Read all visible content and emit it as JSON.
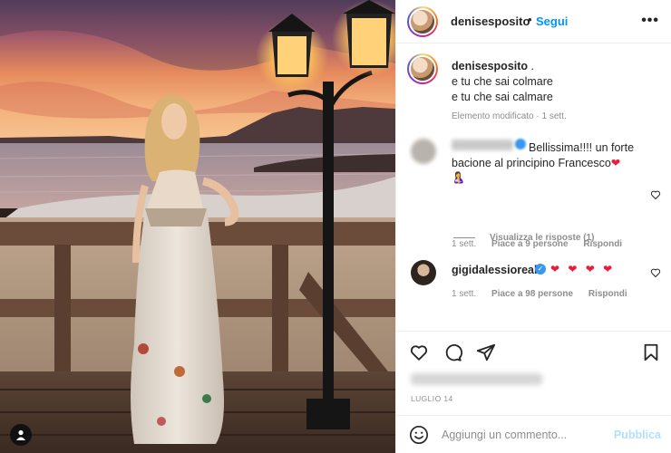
{
  "post": {
    "author": "denisesposito",
    "follow_label": "Segui",
    "header_separator": "•",
    "more_label": "•••"
  },
  "caption": {
    "username": "denisesposito",
    "text_suffix": " .",
    "line2": "e tu che sai colmare",
    "line3": "e tu che sai calmare",
    "meta": "Elemento modificato · 1 sett."
  },
  "comments": [
    {
      "username_blurred": true,
      "text": "Bellissima!!!! un forte",
      "text_line2": "bacione al principino Francesco",
      "trailing_emoji": "❤",
      "line3_emoji": "🤱",
      "time": "1 sett.",
      "likes": "Piace a 9 persone",
      "reply_label": "Rispondi",
      "view_replies": "Visualizza le risposte (1)"
    },
    {
      "username": "gigidalessioreal",
      "verified_mark": "✓",
      "text": "❤ ❤ ❤ ❤",
      "time": "1 sett.",
      "likes": "Piace a 98 persone",
      "reply_label": "Rispondi"
    }
  ],
  "actions": {
    "date": "LUGLIO 14",
    "icons": [
      "heart-icon",
      "comment-icon",
      "share-icon",
      "bookmark-icon"
    ]
  },
  "comment_box": {
    "placeholder": "Aggiungi un commento...",
    "publish_label": "Pubblica"
  },
  "colors": {
    "accent": "#0095f6",
    "publish_disabled": "#b2dffc",
    "heart": "#ed1a3b",
    "meta_text": "#8e8e8e"
  }
}
